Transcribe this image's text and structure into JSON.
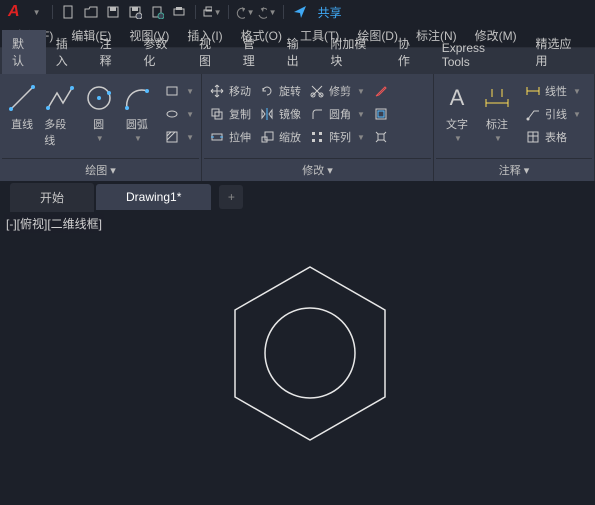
{
  "titlebar": {
    "share": "共享"
  },
  "menubar": {
    "items": [
      "文件(F)",
      "编辑(E)",
      "视图(V)",
      "插入(I)",
      "格式(O)",
      "工具(T)",
      "绘图(D)",
      "标注(N)",
      "修改(M)"
    ]
  },
  "ribbon_tabs": {
    "active": "默认",
    "items": [
      "默认",
      "插入",
      "注释",
      "参数化",
      "视图",
      "管理",
      "输出",
      "附加模块",
      "协作",
      "Express Tools",
      "精选应用"
    ]
  },
  "ribbon": {
    "draw": {
      "title": "绘图 ▾",
      "line": "直线",
      "polyline": "多段线",
      "circle": "圆",
      "arc": "圆弧"
    },
    "modify": {
      "title": "修改 ▾",
      "move": "移动",
      "copy": "复制",
      "stretch": "拉伸",
      "rotate": "旋转",
      "mirror": "镜像",
      "scale": "缩放",
      "trim": "修剪",
      "fillet": "圆角",
      "array": "阵列"
    },
    "annotate": {
      "title": "注释 ▾",
      "text": "文字",
      "dim": "标注",
      "linetype": "线性",
      "leader": "引线",
      "table": "表格"
    }
  },
  "doc_tabs": {
    "start": "开始",
    "drawing": "Drawing1*",
    "plus": "+"
  },
  "viewport": {
    "label": "[-][俯视][二维线框]"
  }
}
